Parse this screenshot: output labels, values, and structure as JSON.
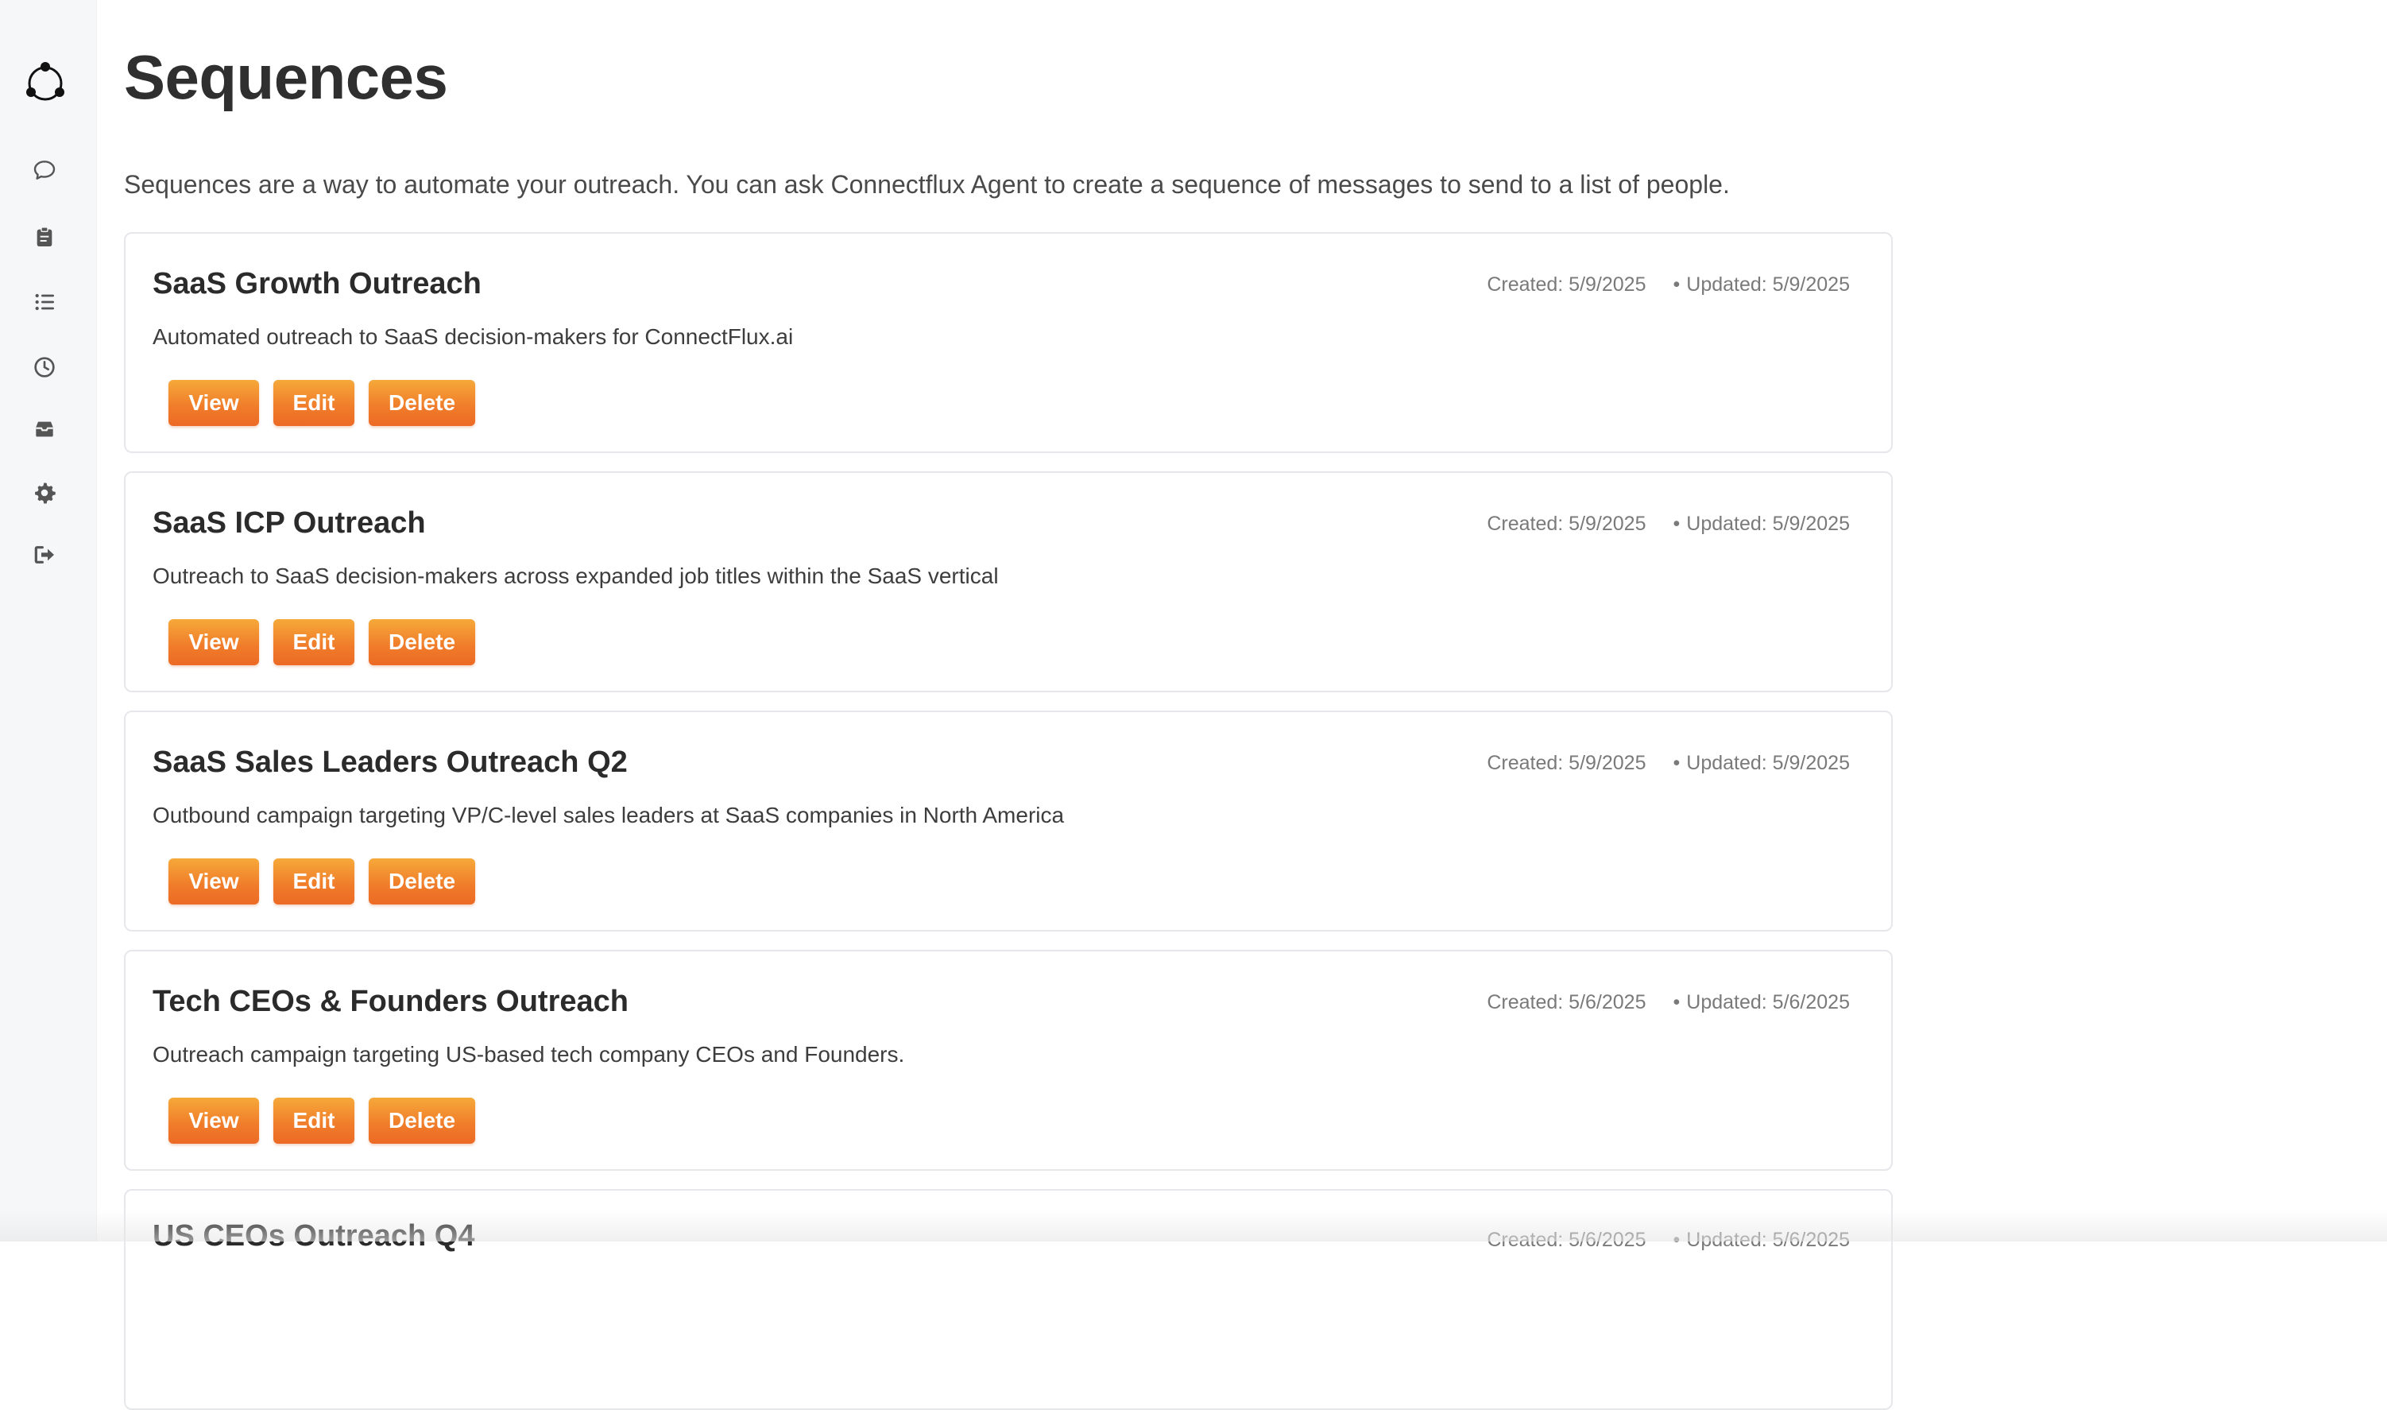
{
  "sidebar": {
    "icons": [
      "logo-icon",
      "chat-icon",
      "clipboard-icon",
      "list-icon",
      "history-icon",
      "inbox-icon",
      "settings-icon",
      "logout-icon"
    ]
  },
  "page": {
    "title": "Sequences",
    "intro": "Sequences are a way to automate your outreach. You can ask Connectflux Agent to create a sequence of messages to send to a list of people."
  },
  "buttons": {
    "view": "View",
    "edit": "Edit",
    "delete": "Delete"
  },
  "meta_separator": "•",
  "sequences": [
    {
      "title": "SaaS Growth Outreach",
      "description": "Automated outreach to SaaS decision-makers for ConnectFlux.ai",
      "created": "Created: 5/9/2025",
      "updated": "Updated: 5/9/2025"
    },
    {
      "title": "SaaS ICP Outreach",
      "description": "Outreach to SaaS decision-makers across expanded job titles within the SaaS vertical",
      "created": "Created: 5/9/2025",
      "updated": "Updated: 5/9/2025"
    },
    {
      "title": "SaaS Sales Leaders Outreach Q2",
      "description": "Outbound campaign targeting VP/C-level sales leaders at SaaS companies in North America",
      "created": "Created: 5/9/2025",
      "updated": "Updated: 5/9/2025"
    },
    {
      "title": "Tech CEOs & Founders Outreach",
      "description": "Outreach campaign targeting US-based tech company CEOs and Founders.",
      "created": "Created: 5/6/2025",
      "updated": "Updated: 5/6/2025"
    },
    {
      "title": "US CEOs Outreach Q4",
      "description": "",
      "created": "Created: 5/6/2025",
      "updated": "Updated: 5/6/2025"
    }
  ],
  "colors": {
    "accent_start": "#f6a93a",
    "accent_end": "#ec6a25",
    "sidebar_bg": "#f6f7f9",
    "card_border": "#e5e7ea"
  }
}
